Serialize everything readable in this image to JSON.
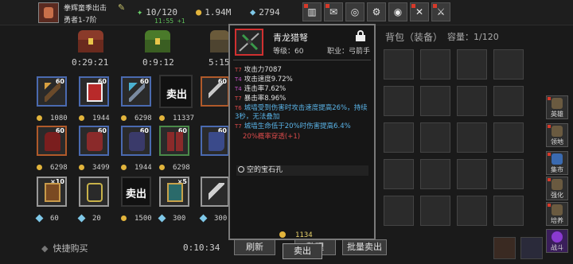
{
  "player": {
    "name": "拳辉童季出击",
    "rank": "勇者1-7阶"
  },
  "resources": {
    "energy": "10/120",
    "energy_regen": "11:55 +1",
    "gold": "1.94M",
    "gems": "2794"
  },
  "chests": {
    "timers": [
      "0:29:21",
      "0:9:12",
      "5:15"
    ]
  },
  "items": {
    "row1": [
      {
        "count": "60",
        "price": "1080"
      },
      {
        "count": "60",
        "price": "1944"
      },
      {
        "count": "60",
        "price": "6298"
      },
      {
        "count": "",
        "price": "11337",
        "sell_label": "卖出"
      },
      {
        "count": "60",
        "price": ""
      }
    ],
    "row2": [
      {
        "count": "60",
        "price": "6298"
      },
      {
        "count": "60",
        "price": "3499"
      },
      {
        "count": "60",
        "price": "1944"
      },
      {
        "count": "60",
        "price": "6298"
      },
      {
        "count": "60",
        "price": ""
      }
    ],
    "row3": [
      {
        "count": "×10",
        "price": "60"
      },
      {
        "count": "",
        "price": "20"
      },
      {
        "count": "",
        "price": "1500",
        "sell_label": "卖出"
      },
      {
        "count": "×5",
        "price": "300"
      },
      {
        "count": "",
        "price": "300"
      }
    ]
  },
  "bottom": {
    "quickbuy": "快捷购买",
    "timer": "0:10:34",
    "refresh": "刷新",
    "organize": "整理",
    "bulk_sell": "批量卖出"
  },
  "bag": {
    "title": "背包（装备）",
    "capacity": "容量：1/120"
  },
  "side_buttons": [
    "英雄",
    "领地",
    "集市",
    "强化",
    "培养",
    "战斗"
  ],
  "tooltip": {
    "name": "青龙猎弩",
    "level": "等级：60",
    "job": "职业：弓箭手",
    "attributes": [
      {
        "tier": "T7",
        "text": "攻击力7087",
        "tone": "white"
      },
      {
        "tier": "T4",
        "text": "攻击速度9.72%",
        "tone": "white"
      },
      {
        "tier": "T4",
        "text": "连击率7.62%",
        "tone": "white"
      },
      {
        "tier": "T7",
        "text": "暴击率8.96%",
        "tone": "white"
      },
      {
        "tier": "T6",
        "text": "城墙受到伤害时攻击速度提高26%，持续3秒，无法叠加",
        "tone": "blue"
      },
      {
        "tier": "T7",
        "text": "城墙生命低于20%时伤害提高6.4%",
        "tone": "blue"
      },
      {
        "tier": "",
        "text": "20%概率穿透(+1)",
        "tone": "red"
      }
    ],
    "gem_slot": "空的宝石孔",
    "price": "1134",
    "sell": "卖出"
  },
  "colors": {
    "tooltip_border": "#7a7a7a",
    "accent_red": "#d03030",
    "link_blue": "#5ab4e8"
  }
}
